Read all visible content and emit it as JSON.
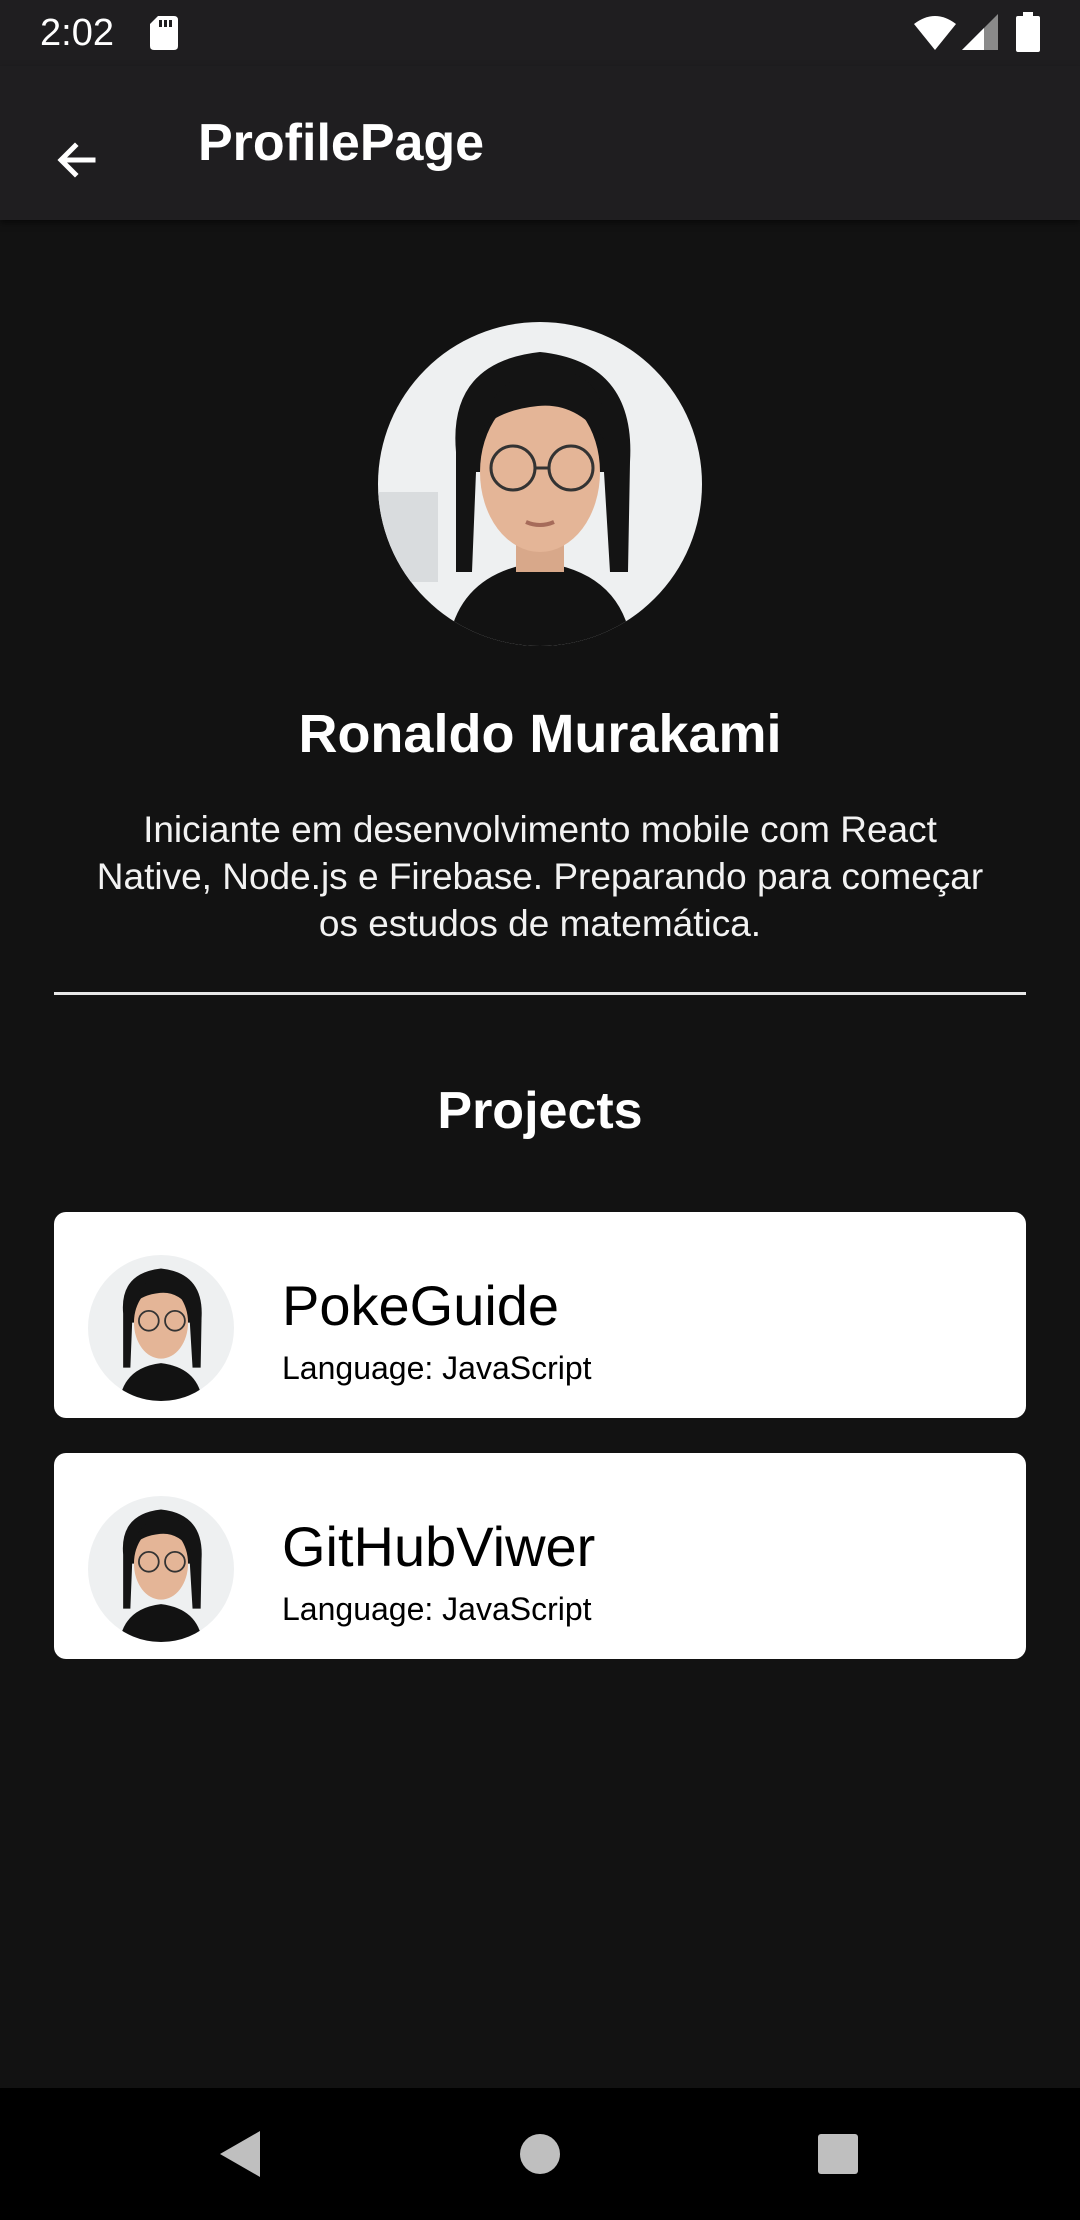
{
  "status_bar": {
    "time": "2:02",
    "icons": [
      "sd-card-icon",
      "wifi-icon",
      "cell-signal-icon",
      "battery-icon"
    ]
  },
  "app_bar": {
    "back_icon": "arrow-left-icon",
    "title": "ProfilePage"
  },
  "profile": {
    "photo": "profile-photo",
    "name": "Ronaldo Murakami",
    "bio": "Iniciante em desenvolvimento mobile com React Native, Node.js e Firebase. Preparando para começar os estudos de matemática."
  },
  "projects": {
    "title": "Projects",
    "items": [
      {
        "name": "PokeGuide",
        "language": "Language: JavaScript"
      },
      {
        "name": "GitHubViwer",
        "language": "Language: JavaScript"
      }
    ]
  },
  "nav_bar": {
    "buttons": [
      "nav-back-icon",
      "nav-home-icon",
      "nav-recents-icon"
    ]
  },
  "colors": {
    "background": "#121212",
    "app_bar": "#1f1e20",
    "card": "#ffffff",
    "text_primary": "#ffffff",
    "nav_bar": "#000000"
  }
}
